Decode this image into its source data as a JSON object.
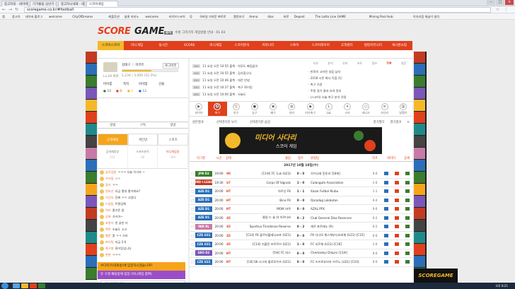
{
  "browser": {
    "tabs": [
      {
        "label": "중고차의 · 네이버 통합"
      },
      {
        "label": "기가출을 삼산기 · 중고"
      },
      {
        "label": "중고차시세표 · 네이버"
      },
      {
        "label": "스코어게임"
      }
    ],
    "url": "scoregame.co.kr/#football",
    "bookmarks": [
      "앱",
      "중고차",
      "네이버 블로그",
      "welcome",
      "CityOfDreams",
      "레볼루션",
      "슬롯 카지노",
      "welcome",
      "라이브스코어",
      "Q",
      "모바일 가까운 뽀로로",
      "랭킹보기",
      "Arena",
      "dios",
      "바로",
      "Depost",
      "The Lotto Line GAME",
      "Mining Pool Hub",
      "이더리움 채굴기 설치"
    ]
  },
  "header": {
    "logo_part1": "SCORE",
    "logo_part2": "GAME",
    "notice_tag": "공지",
    "notice_text": "수원 그라기지 게임방법 안내 · 01.03"
  },
  "main_nav": {
    "items": [
      "스코어스코어",
      "미니게임",
      "실시간",
      "SCORE",
      "미니게임",
      "스코어분석",
      "커뮤니티",
      "스토어",
      "스코어레이어",
      "고객센터",
      "랭킹커뮤니티",
      "게시판쇼핑"
    ],
    "active_index": 0
  },
  "left": {
    "profile_name": "김태구 ♡ 미르트",
    "level_text": "Lv.18 회원",
    "exp_text": "1,234 / 3,000 (52.3%)",
    "exp_percent": 52,
    "btn_mypage": "마이룸",
    "btn_msg": "쪽지",
    "btn_item": "아이템",
    "btn_gift": "선물",
    "btn_logout": "로그아웃",
    "points": [
      "10",
      "0",
      "0",
      "12"
    ],
    "tabs1": [
      "알림",
      "구독",
      "댓글"
    ],
    "tabs2": [
      "공개채팅",
      "개인방",
      "스포츠"
    ],
    "rooms": [
      {
        "label": "공개채팅방",
        "count": "152"
      },
      {
        "label": "스포츠분석",
        "count": "48"
      },
      {
        "label": "미니게임방",
        "count": "309"
      }
    ],
    "chat": [
      {
        "nick": "삼각김밥",
        "text": "ㅋㅋㅋ 오늘 이기자 ~"
      },
      {
        "nick": "우리집",
        "text": "ㅇㅇ"
      },
      {
        "nick": "몽키",
        "text": "ㅋㅋ"
      },
      {
        "nick": "한라산",
        "text": "지금 몇대 몇이에요?"
      },
      {
        "nick": "이긴다",
        "text": "진짜 ㅋㅋ 고맙다"
      },
      {
        "nick": "드림팀",
        "text": "트렌업해"
      },
      {
        "nick": "럭키",
        "text": "즐거운 밤"
      },
      {
        "nick": "상위",
        "text": "가즈아~"
      },
      {
        "nick": "호랑이",
        "text": "한 골만 더"
      },
      {
        "nick": "맥주",
        "text": "오늘도 고고"
      },
      {
        "nick": "행운",
        "text": "흠 ㅋㅋ 가자"
      },
      {
        "nick": "파이팅",
        "text": "지금 2:0"
      },
      {
        "nick": "축구왕",
        "text": "화이팅입니다"
      },
      {
        "nick": "한판",
        "text": "ㅋㅋㅋ"
      }
    ],
    "room_btn1": "수다지기(대화방)에 입장하시겠습니까?",
    "room_btn2": "유 구경 채팅방에 입장 (미니게임 참여)",
    "chat_placeholder": "채팅 입력하세요"
  },
  "board": {
    "left_rows": [
      {
        "no": "281",
        "text": "11 요일 오전 10:55 출첵 · 하루도 빠짐없이"
      },
      {
        "no": "281",
        "text": "11 요일 오전 10:55 출첵 · 감사합니다"
      },
      {
        "no": "281",
        "text": "11 요일 오전 10:46 출첵 · 대전 안녕"
      },
      {
        "no": "281",
        "text": "11 요일 오전 10:27 출첵 · 축구 화이팅"
      },
      {
        "no": "281",
        "text": "11 요일 오전 10:00 출첵 · 오늘도"
      }
    ],
    "right_tabs": [
      "자유",
      "분석",
      "유머",
      "포토",
      "정보",
      "TIP",
      "질문"
    ],
    "right_active": 5,
    "right_rows": [
      "한화의 고비된 실점 남자",
      "2018 시즌 최다 득점 (1)",
      "축구 기권",
      "주말 경기 결과 요약 정리",
      "(스코어) 오늘 축구 분석 전망"
    ]
  },
  "sports": {
    "items": [
      {
        "label": "라이브",
        "icon": "live-icon",
        "glyph": "▶"
      },
      {
        "label": "축구",
        "icon": "soccer-icon",
        "glyph": "⚽"
      },
      {
        "label": "야구",
        "icon": "baseball-icon",
        "glyph": "⚾"
      },
      {
        "label": "농구",
        "icon": "basketball-icon",
        "glyph": "●"
      },
      {
        "label": "배구",
        "icon": "volleyball-icon",
        "glyph": "◉"
      },
      {
        "label": "하키",
        "icon": "hockey-icon",
        "glyph": "◍"
      },
      {
        "label": "미식축구",
        "icon": "football-icon",
        "glyph": "◆"
      },
      {
        "label": "LoL",
        "icon": "lol-icon",
        "glyph": "L"
      },
      {
        "label": "스타",
        "icon": "star-icon",
        "glyph": "✦"
      },
      {
        "label": "테니스",
        "icon": "tennis-icon",
        "glyph": "○"
      },
      {
        "label": "사다리",
        "icon": "ladder-icon",
        "glyph": "≡"
      },
      {
        "label": "달팽이",
        "icon": "snail-icon",
        "glyph": "@"
      }
    ],
    "active_index": 1
  },
  "filter": {
    "f1": "원본결과",
    "f2": "선택경기만 보기",
    "f3": "선택경기만 숨김",
    "f4": "경기필터",
    "f5": "경기결과"
  },
  "banner": {
    "title": "미디어 사다리",
    "sub": "스코어 게임",
    "logo": "SCOREGAME"
  },
  "table": {
    "headers": [
      "리그명",
      "시간",
      "상태",
      "홈팀",
      "점수",
      "원정팀",
      "하프",
      "데이터",
      "상세"
    ],
    "date": "2017년 10월 18일(수)",
    "rows": [
      {
        "league": "JPN D3",
        "lg_color": "#3a7d2e",
        "time": "19:00",
        "status": "90",
        "home": "[11위] FC 도쿄 (U23)",
        "score": "0 - 0",
        "away": "가이나레 돗토리 [18위]",
        "half": "0-0"
      },
      {
        "league": "IND I-LEAGUE",
        "lg_color": "#c23b22",
        "time": "19:30",
        "status": "67",
        "home": "Corps Of Signals",
        "score": "1 - 0",
        "away": "Calangute Association",
        "half": "1-0"
      },
      {
        "league": "AZE D1",
        "lg_color": "#2a6fb8",
        "time": "20:00",
        "status": "HT",
        "home": "아르신 FK",
        "score": "1 - 1",
        "away": "Xazar Futbol Klubu",
        "half": "1-1"
      },
      {
        "league": "AZE D1",
        "lg_color": "#2a6fb8",
        "time": "20:00",
        "status": "HT",
        "home": "Bina FK",
        "score": "0 - 0",
        "away": "Qaradag Lokbatan",
        "half": "0-0"
      },
      {
        "league": "AZE D1",
        "lg_color": "#2a6fb8",
        "time": "20:00",
        "status": "HT",
        "home": "MOIK 바쿠",
        "score": "0 - 0",
        "away": "AZAL PFK",
        "half": "0-0"
      },
      {
        "league": "AZE D1",
        "lg_color": "#2a6fb8",
        "time": "20:00",
        "status": "45",
        "home": "클럽 드 술 야 아르디바",
        "score": "0 - 2",
        "away": "Club General Diaz Reserves",
        "half": "0-2"
      },
      {
        "league": "PAR RL",
        "lg_color": "#c77aa6",
        "time": "20:00",
        "status": "45",
        "home": "Sportivo Trinidense Reserve",
        "score": "0 - 2",
        "away": "게르 포르테노 (R)",
        "half": "0-2"
      },
      {
        "league": "CZE U21",
        "lg_color": "#2a6fb8",
        "time": "20:00",
        "status": "45",
        "home": "[C14] FK 플르티블레니코프 (U21)",
        "score": "0 - 0",
        "away": "FK 디너모 체스케부디요비체 (U21) [C15]",
        "half": "0-0"
      },
      {
        "league": "CZE U21",
        "lg_color": "#2a6fb8",
        "time": "20:00",
        "status": "45",
        "home": "[C14] 즈블린 프르르브 (U21)",
        "score": "1 - 0",
        "away": "FC 지르체 (U21) [C16]",
        "half": "1-0"
      },
      {
        "league": "SKO D2",
        "lg_color": "#7a57b8",
        "time": "20:00",
        "status": "HT",
        "home": "[5위] FC 비스",
        "score": "0 - 0",
        "away": "Cherkaskyi Dnipro [11위]",
        "half": "0-0"
      },
      {
        "league": "CZE U21",
        "lg_color": "#2a6fb8",
        "time": "20:00",
        "status": "HT",
        "home": "[C8] SK 시그마 올로모우츠 (U21)",
        "score": "0 - 0",
        "away": "FC 즈브로요브카 브르노 (U21) [C10]",
        "half": "0-0"
      }
    ]
  },
  "ad": {
    "label": "SCOREGAME"
  },
  "taskbar": {
    "clock": "오후 8:21"
  }
}
